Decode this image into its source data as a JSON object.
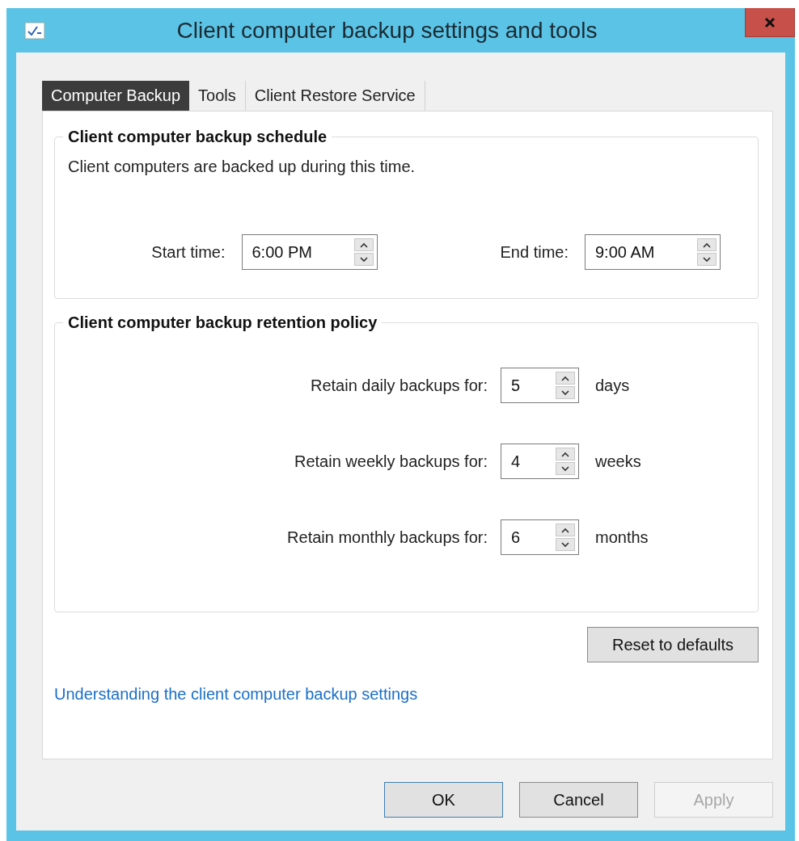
{
  "window": {
    "title": "Client computer backup settings and tools"
  },
  "tabs": [
    {
      "label": "Computer Backup",
      "selected": true
    },
    {
      "label": "Tools",
      "selected": false
    },
    {
      "label": "Client Restore Service",
      "selected": false
    }
  ],
  "schedule": {
    "title": "Client computer backup schedule",
    "description": "Client computers are backed up during this time.",
    "fields": [
      {
        "label": "Start time:",
        "value": "6:00 PM"
      },
      {
        "label": "End time:",
        "value": "9:00 AM"
      }
    ]
  },
  "retention": {
    "title": "Client computer backup retention policy",
    "rows": [
      {
        "label": "Retain daily backups for:",
        "value": "5",
        "unit": "days"
      },
      {
        "label": "Retain weekly backups for:",
        "value": "4",
        "unit": "weeks"
      },
      {
        "label": "Retain monthly backups for:",
        "value": "6",
        "unit": "months"
      }
    ]
  },
  "reset_button": "Reset to defaults",
  "help_link": "Understanding the client computer backup settings",
  "buttons": [
    {
      "label": "OK",
      "default": true,
      "disabled": false
    },
    {
      "label": "Cancel",
      "default": false,
      "disabled": false
    },
    {
      "label": "Apply",
      "default": false,
      "disabled": true
    }
  ]
}
